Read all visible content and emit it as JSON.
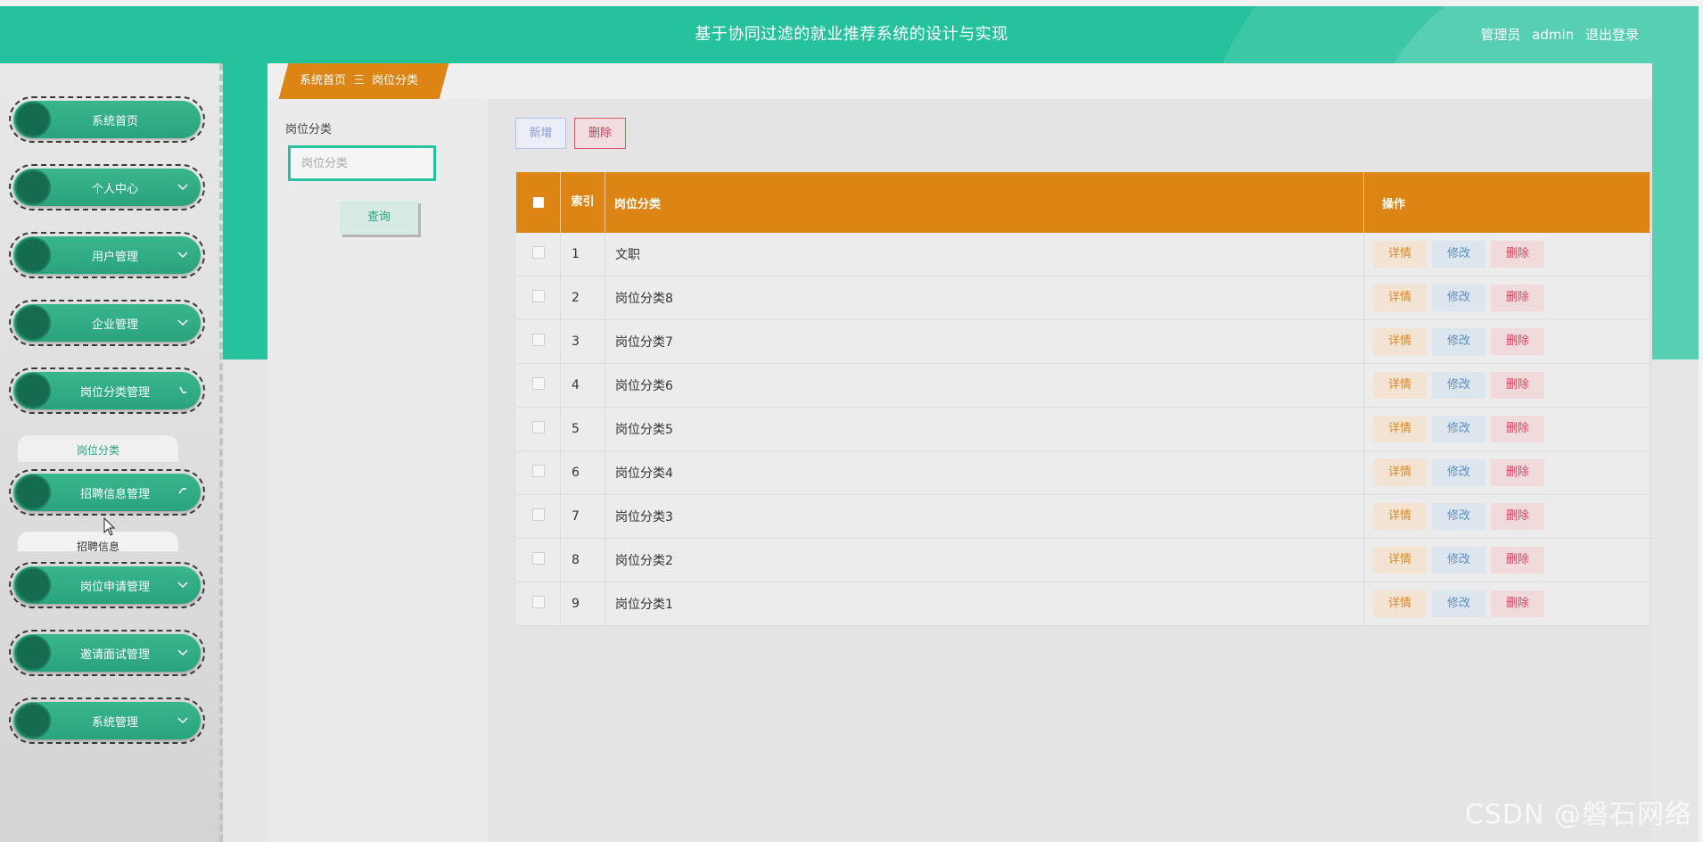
{
  "header": {
    "title": "基于协同过滤的就业推荐系统的设计与实现",
    "user_role": "管理员",
    "username": "admin",
    "logout": "退出登录"
  },
  "sidebar": {
    "items": [
      {
        "label": "系统首页"
      },
      {
        "label": "个人中心"
      },
      {
        "label": "用户管理"
      },
      {
        "label": "企业管理"
      },
      {
        "label": "岗位分类管理",
        "expanded": true,
        "children": [
          "岗位分类"
        ]
      },
      {
        "label": "招聘信息管理",
        "expanded": true,
        "children": [
          "招聘信息"
        ]
      },
      {
        "label": "岗位申请管理"
      },
      {
        "label": "邀请面试管理"
      },
      {
        "label": "系统管理"
      }
    ]
  },
  "breadcrumb": {
    "home": "系统首页",
    "separator": "三",
    "current": "岗位分类"
  },
  "filter": {
    "label": "岗位分类",
    "placeholder": "岗位分类",
    "search_button": "查询"
  },
  "actions": {
    "add": "新增",
    "delete": "删除"
  },
  "table": {
    "headers": {
      "index": "索引",
      "name": "岗位分类",
      "ops": "操作"
    },
    "op_labels": {
      "detail": "详情",
      "edit": "修改",
      "delete": "删除"
    },
    "rows": [
      {
        "index": "1",
        "name": "文职"
      },
      {
        "index": "2",
        "name": "岗位分类8"
      },
      {
        "index": "3",
        "name": "岗位分类7"
      },
      {
        "index": "4",
        "name": "岗位分类6"
      },
      {
        "index": "5",
        "name": "岗位分类5"
      },
      {
        "index": "6",
        "name": "岗位分类4"
      },
      {
        "index": "7",
        "name": "岗位分类3"
      },
      {
        "index": "8",
        "name": "岗位分类2"
      },
      {
        "index": "9",
        "name": "岗位分类1"
      }
    ]
  },
  "watermark": "CSDN @磐石网络",
  "colors": {
    "primary": "#26c19d",
    "accent": "#dc8514",
    "menu": "#2aa37d"
  }
}
